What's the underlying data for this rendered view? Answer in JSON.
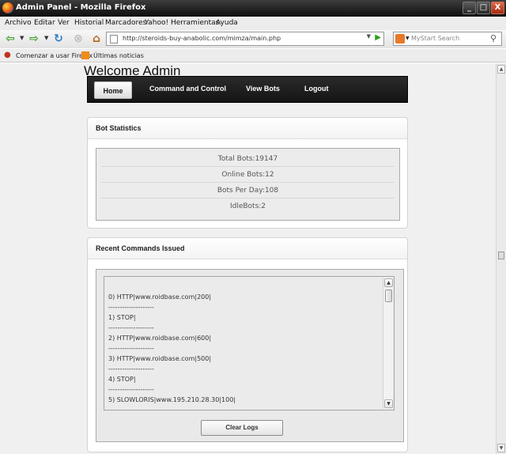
{
  "window": {
    "title": "Admin Panel - Mozilla Firefox",
    "minimize": "_",
    "maximize": "□",
    "close": "X"
  },
  "menu": [
    "Archivo",
    "Editar",
    "Ver",
    "Historial",
    "Marcadores",
    "Yahoo!",
    "Herramientas",
    "Ayuda"
  ],
  "navbar": {
    "url": "http://steroids-buy-anabolic.com/mimza/main.php",
    "search_placeholder": "MyStart Search"
  },
  "bookmarks": [
    "Comenzar a usar Firefox",
    "Últimas noticias"
  ],
  "page": {
    "welcome": "Welcome Admin",
    "nav": [
      "Home",
      "Command and Control",
      "View Bots",
      "Logout"
    ],
    "stats": {
      "title": "Bot Statistics",
      "rows": [
        "Total Bots:19147",
        "Online Bots:12",
        "Bots Per Day:108",
        "IdleBots:2"
      ]
    },
    "commands": {
      "title": "Recent Commands Issued",
      "lines": [
        "0) HTTP|www.roidbase.com|200|",
        "--------------------",
        "1) STOP|",
        "--------------------",
        "2) HTTP|www.roidbase.com|600|",
        "--------------------",
        "3) HTTP|www.roidbase.com|500|",
        "--------------------",
        "4) STOP|",
        "--------------------",
        "5) SLOWLORIS|www.195.210.28.30|100|",
        "--------------------"
      ],
      "clear_button": "Clear Logs"
    }
  },
  "colors": {
    "titlebar": "#1a1a1a",
    "nav_bar": "#1f1f1f",
    "go_arrow": "#2f9d1c"
  }
}
